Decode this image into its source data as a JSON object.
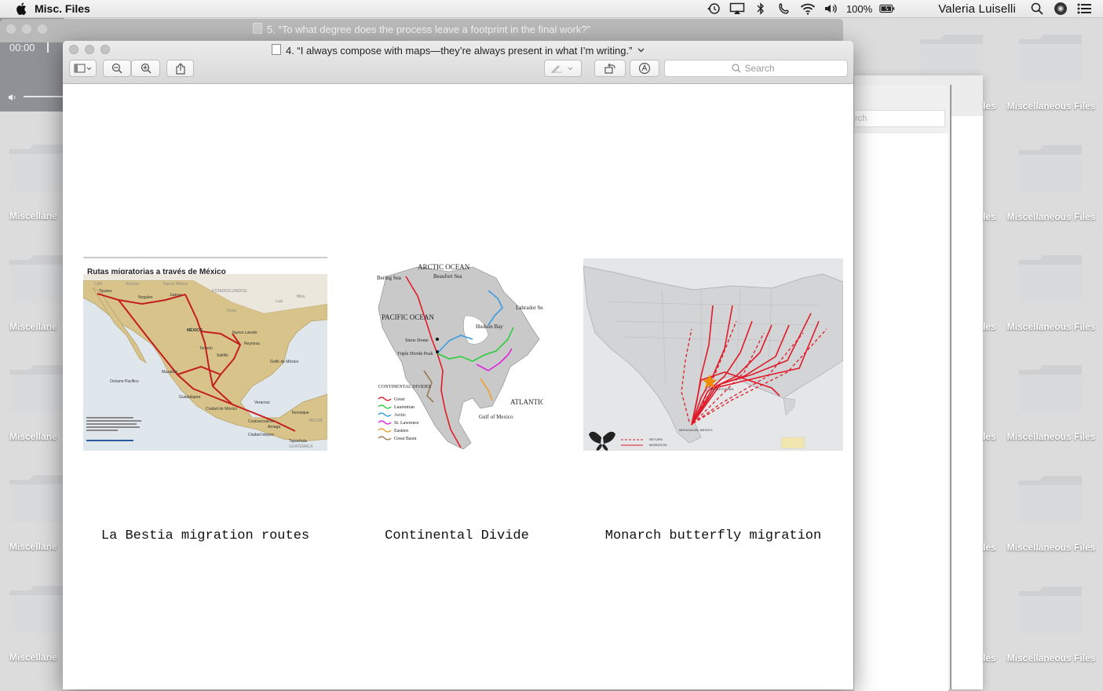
{
  "menubar": {
    "app_name": "Misc. Files",
    "battery": "100%",
    "user": "Valeria Luiselli",
    "icons": [
      "apple-icon",
      "time-machine-icon",
      "airplay-icon",
      "bluetooth-icon",
      "phone-icon",
      "wifi-icon",
      "volume-icon",
      "battery-icon",
      "search-icon",
      "siri-icon",
      "notification-center-icon"
    ]
  },
  "desktop": {
    "folder_label": "Miscellaneous Files",
    "left_partial_label": "Miscellane",
    "right_partial_label": "les"
  },
  "player": {
    "time": "00:00"
  },
  "back_window": {
    "title": "5. “To what degree does the process leave a footprint in the final work?”",
    "search_partial": "rch"
  },
  "main_window": {
    "title": "4. “I always compose with maps—they’re always present in what I’m writing.”",
    "search_placeholder": "Search",
    "toolbar": [
      "sidebar-toggle",
      "zoom-out",
      "zoom-in",
      "share",
      "markup-pen",
      "rotate",
      "annotate"
    ]
  },
  "document": {
    "maps": [
      {
        "caption": "La Bestia migration routes",
        "map_title": "Rutas migratorias a través de México",
        "places": [
          "Tijuana",
          "Nogales",
          "Juárez",
          "MÉXICO",
          "Nuevo Laredo",
          "Reynosa",
          "Torreón",
          "Saltillo",
          "Mazatlán",
          "Guadalajara",
          "Ciudad de México",
          "Veracruz",
          "Coatzacoalcos",
          "Tenosique",
          "Ciudad Ixtepec",
          "Arriaga",
          "Tapachula"
        ],
        "regions": [
          "Calif.",
          "Arizona",
          "Nuevo México",
          "ESTADOS UNIDOS",
          "Texas",
          "Miss.",
          "Luis.",
          "Golfo de México",
          "Océano Pacífico",
          "BELIZE",
          "GUATEMALA"
        ]
      },
      {
        "caption": "Continental Divide",
        "labels": [
          "ARCTIC OCEAN",
          "Beaufort Sea",
          "Bering Sea",
          "Labrador Sea",
          "PACIFIC OCEAN",
          "Hudson Bay",
          "Snow Dome",
          "Triple Divide Peak",
          "ATLANTIC OCEAN",
          "Gulf of Mexico"
        ],
        "legend_title": "CONTINENTAL DIVIDES",
        "legend": [
          {
            "name": "Great",
            "color": "#e01b2a"
          },
          {
            "name": "Laurentian",
            "color": "#2ecc40"
          },
          {
            "name": "Arctic",
            "color": "#3a9be0"
          },
          {
            "name": "St. Lawrence",
            "color": "#e020e0"
          },
          {
            "name": "Eastern",
            "color": "#f0a030"
          },
          {
            "name": "Great Basin",
            "color": "#9b7a55"
          }
        ]
      },
      {
        "caption": "Monarch butterfly migration",
        "labels": [
          "TEXAS FUNNEL",
          "MICHOACÁN, MEXICO"
        ],
        "legend": [
          "RETURN",
          "MIGRATION"
        ]
      }
    ]
  }
}
